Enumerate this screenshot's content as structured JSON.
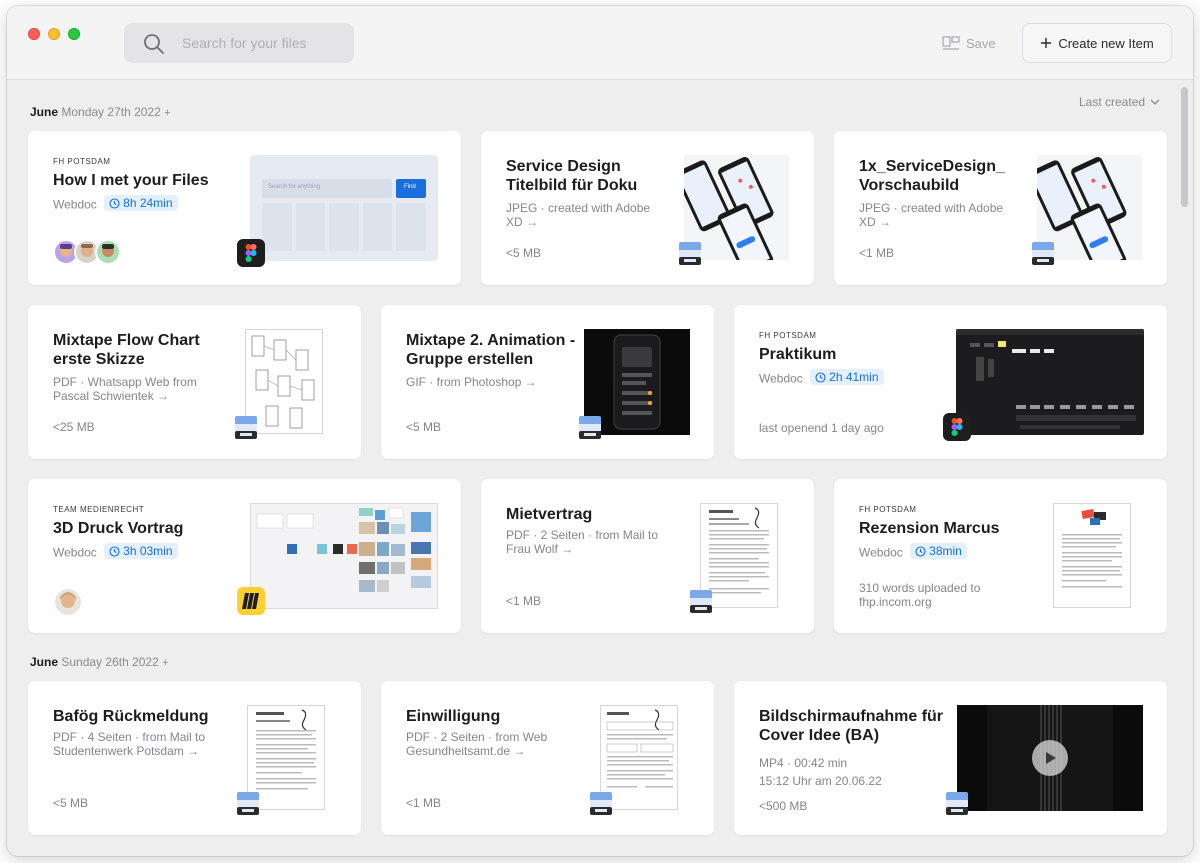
{
  "toolbar": {
    "search_placeholder": "Search for your files",
    "save_label": "Save",
    "create_label": "Create new Item"
  },
  "sort": {
    "label": "Last created"
  },
  "groups": [
    {
      "month": "June",
      "date": "Monday 27th 2022",
      "plus": "+"
    },
    {
      "month": "June",
      "date": "Sunday 26th 2022",
      "plus": "+"
    }
  ],
  "cards": [
    {
      "tag": "FH POTSDAM",
      "title": "How I met your Files",
      "type": "Webdoc",
      "duration": "8h 24min",
      "thumb_search": "Search for anything",
      "thumb_button": "Find",
      "app": "figma"
    },
    {
      "title": "Service Design Titelbild für Doku",
      "sub": "JPEG · created with Adobe XD →",
      "meta": "<5 MB",
      "app": "preview"
    },
    {
      "title": "1x_ServiceDesign_ Vorschaubild",
      "sub": "JPEG · created with Adobe XD →",
      "meta": "<1 MB",
      "app": "preview"
    },
    {
      "title": "Mixtape Flow Chart erste Skizze",
      "sub": "PDF · Whatsapp Web from Pascal Schwientek →",
      "meta": "<25 MB",
      "app": "preview"
    },
    {
      "title": "Mixtape 2. Animation - Gruppe erstellen",
      "sub": "GIF · from Photoshop →",
      "meta": "<5 MB",
      "app": "preview"
    },
    {
      "tag": "FH POTSDAM",
      "title": "Praktikum",
      "type": "Webdoc",
      "duration": "2h 41min",
      "meta": "last openend 1 day ago",
      "app": "figma"
    },
    {
      "tag": "TEAM MEDIENRECHT",
      "title": "3D Druck Vortrag",
      "type": "Webdoc",
      "duration": "3h 03min",
      "app": "miro"
    },
    {
      "title": "Mietvertrag",
      "sub": "PDF · 2 Seiten · from Mail to Frau Wolf →",
      "meta": "<1 MB",
      "app": "preview"
    },
    {
      "tag": "FH POTSDAM",
      "title": "Rezension Marcus",
      "type": "Webdoc",
      "duration": "38min",
      "meta": "310 words uploaded to fhp.incom.org"
    },
    {
      "title": "Bafög Rückmeldung",
      "sub": "PDF · 4 Seiten · from Mail to Studentenwerk Potsdam →",
      "meta": "<5 MB",
      "app": "preview"
    },
    {
      "title": "Einwilligung",
      "sub": "PDF · 2 Seiten · from Web Gesundheitsamt.de →",
      "meta": "<1 MB",
      "app": "preview"
    },
    {
      "title": "Bildschirmaufnahme für Cover Idee (BA)",
      "sub": "MP4 · 00:42 min",
      "sub2": "15:12 Uhr am 20.06.22",
      "meta": "<500 MB",
      "app": "preview"
    }
  ],
  "colors": {
    "accent": "#1a6fe0",
    "background": "#eeeeef",
    "card": "#ffffff"
  }
}
